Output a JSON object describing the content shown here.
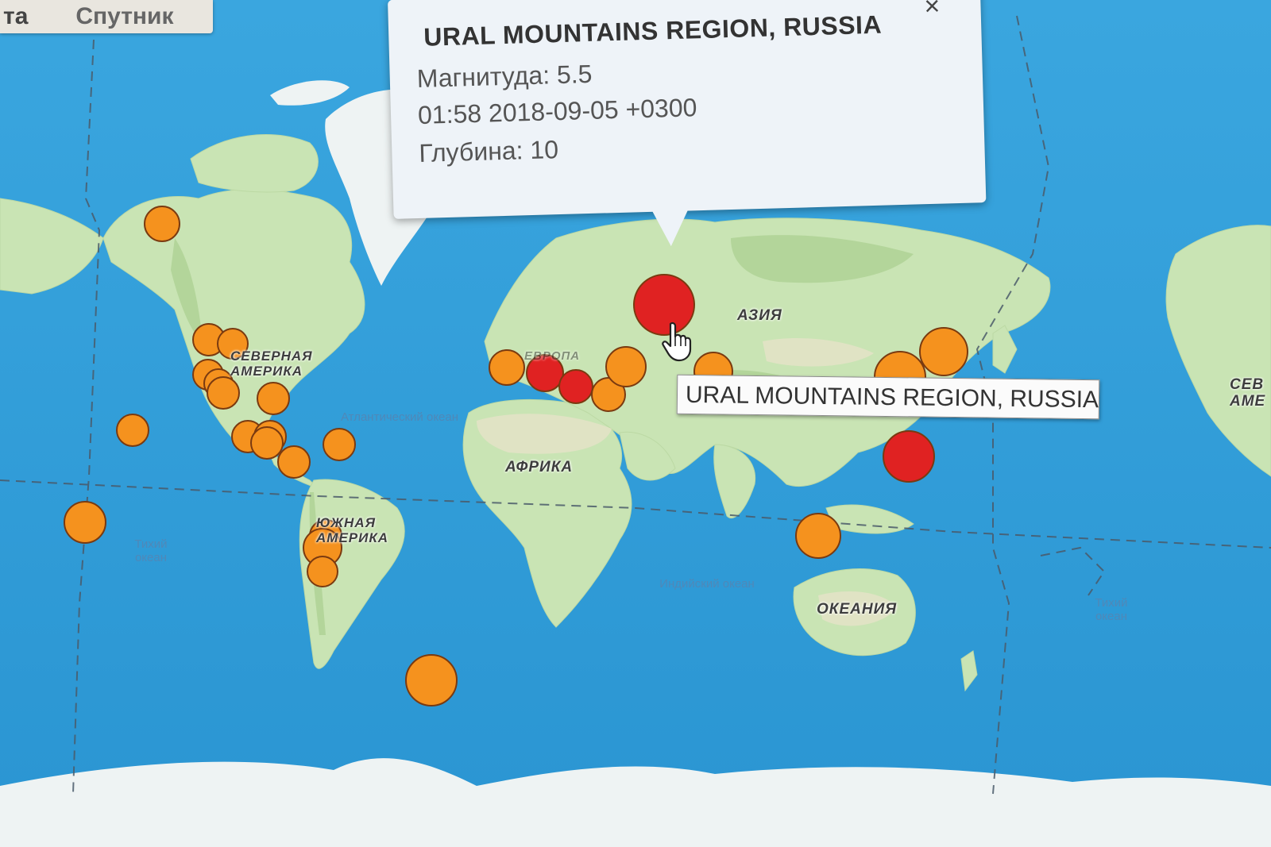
{
  "map_controls": {
    "map_tab": "та",
    "satellite_tab": "Спутник"
  },
  "continent_labels": [
    {
      "id": "asia",
      "text": "АЗИЯ"
    },
    {
      "id": "north-america",
      "text": "СЕВЕРНАЯ АМЕРИКА"
    },
    {
      "id": "south-america",
      "text": "ЮЖНАЯ АМЕРИКА"
    },
    {
      "id": "africa",
      "text": "АФРИКА"
    },
    {
      "id": "oceania",
      "text": "ОКЕАНИЯ"
    },
    {
      "id": "europe",
      "text": "ЕВРОПА"
    },
    {
      "id": "north-america-right",
      "text": "СЕВ АМЕ"
    }
  ],
  "ocean_labels": [
    {
      "id": "atlantic",
      "text": "Атлантический океан"
    },
    {
      "id": "indian",
      "text": "Индийский океан"
    },
    {
      "id": "pacific-left",
      "text": "Тихий океан"
    },
    {
      "id": "pacific-right",
      "text": "Тихий океан"
    }
  ],
  "popup": {
    "title": "URAL MOUNTAINS REGION, RUSSIA",
    "magnitude": "Магнитуда: 5.5",
    "datetime": "01:58 2018-09-05 +0300",
    "depth": "Глубина: 10",
    "close_glyph": "×"
  },
  "tooltip": {
    "text": "URAL MOUNTAINS REGION, RUSSIA"
  },
  "colors": {
    "ocean": "#2f9ed9",
    "land": "#c9e4b4",
    "ice": "#eef3f3",
    "marker_orange": "#f5921e",
    "marker_red": "#e02222",
    "marker_stroke": "#7a3a10"
  },
  "earthquakes": [
    {
      "id": "ural",
      "lon": 58,
      "lat": 58.5,
      "severity": "high"
    }
  ]
}
